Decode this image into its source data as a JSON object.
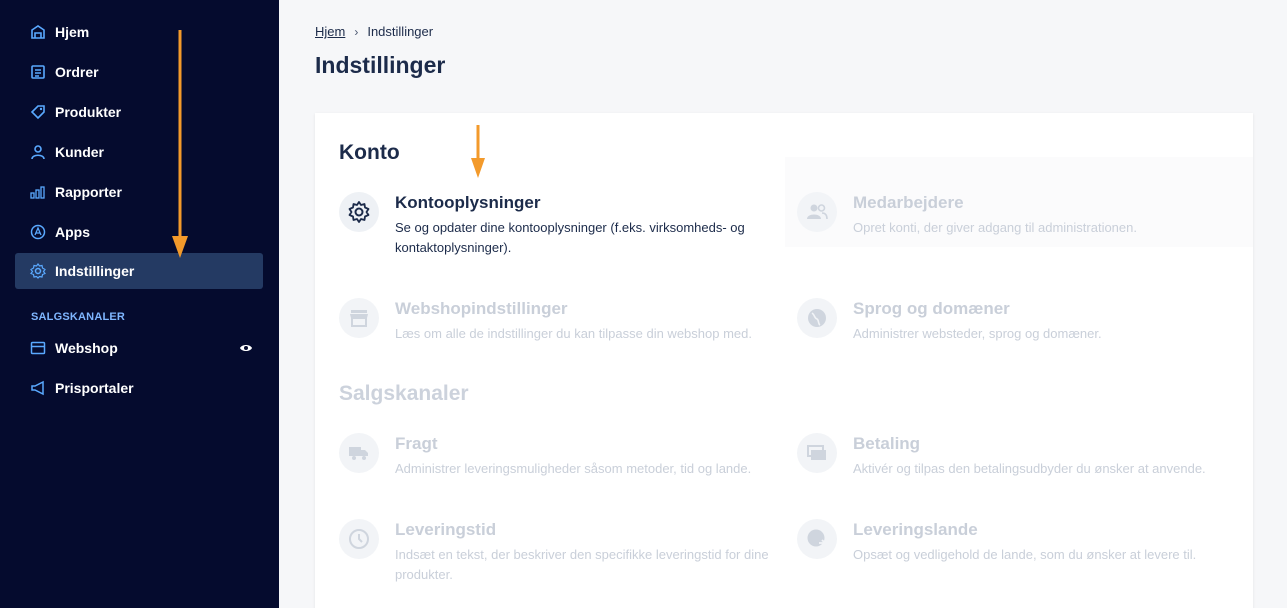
{
  "sidebar": {
    "items": [
      {
        "label": "Hjem",
        "icon": "home-icon"
      },
      {
        "label": "Ordrer",
        "icon": "orders-icon"
      },
      {
        "label": "Produkter",
        "icon": "tag-icon"
      },
      {
        "label": "Kunder",
        "icon": "user-icon"
      },
      {
        "label": "Rapporter",
        "icon": "bar-chart-icon"
      },
      {
        "label": "Apps",
        "icon": "apps-icon"
      },
      {
        "label": "Indstillinger",
        "icon": "gear-icon",
        "active": true
      }
    ],
    "section_label": "SALGSKANALER",
    "channels": [
      {
        "label": "Webshop",
        "icon": "store-icon"
      },
      {
        "label": "Prisportaler",
        "icon": "megaphone-icon"
      }
    ]
  },
  "breadcrumb": {
    "home": "Hjem",
    "current": "Indstillinger"
  },
  "page_title": "Indstillinger",
  "konto": {
    "title": "Konto",
    "items": [
      {
        "title": "Kontooplysninger",
        "desc": "Se og opdater dine kontooplysninger (f.eks. virksomheds- og kontaktoplysninger).",
        "icon": "gear-icon"
      },
      {
        "title": "Medarbejdere",
        "desc": "Opret konti, der giver adgang til administrationen.",
        "icon": "people-icon"
      },
      {
        "title": "Webshopindstillinger",
        "desc": "Læs om alle de indstillinger du kan tilpasse din webshop med.",
        "icon": "store-icon"
      },
      {
        "title": "Sprog og domæner",
        "desc": "Administrer websteder, sprog og domæner.",
        "icon": "globe-icon"
      }
    ]
  },
  "salgskanaler": {
    "title": "Salgskanaler",
    "items": [
      {
        "title": "Fragt",
        "desc": "Administrer leveringsmuligheder såsom metoder, tid og lande.",
        "icon": "truck-icon"
      },
      {
        "title": "Betaling",
        "desc": "Aktivér og tilpas den betalingsudbyder du ønsker at anvende.",
        "icon": "payment-icon"
      },
      {
        "title": "Leveringstid",
        "desc": "Indsæt en tekst, der beskriver den specifikke leveringstid for dine produkter.",
        "icon": "clock-icon"
      },
      {
        "title": "Leveringslande",
        "desc": "Opsæt og vedligehold de lande, som du ønsker at levere til.",
        "icon": "globe-arrow-icon"
      }
    ]
  },
  "colors": {
    "sidebar_bg": "#050b2e",
    "active_bg": "#243a63",
    "accent_icon": "#5aa9ff",
    "arrow": "#f39a2b",
    "text_dark": "#1c2b4a"
  }
}
